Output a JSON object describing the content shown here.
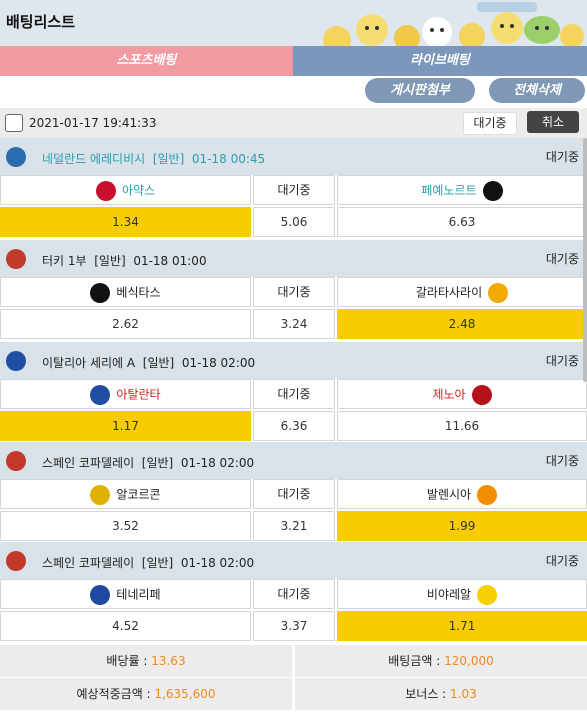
{
  "header": {
    "title": "배팅리스트"
  },
  "tabs": {
    "sports": "스포츠배팅",
    "live": "라이브배팅"
  },
  "actions": {
    "notice": "게시판첨부",
    "delete_all": "전체삭제"
  },
  "datebar": {
    "datetime": "2021-01-17 19:41:33",
    "status": "대기중",
    "cancel": "취소"
  },
  "draw_label": "대기중",
  "matches": [
    {
      "league": "네덜란드 에레디비시",
      "type": "[일반]",
      "time": "01-18 00:45",
      "status": "대기중",
      "home": "아약스",
      "away": "페예노르트",
      "odds_home": "1.34",
      "odds_draw": "5.06",
      "odds_away": "6.63",
      "selected": "home",
      "home_color": "#c8102e",
      "away_color": "#111111"
    },
    {
      "league": "터키 1부",
      "type": "[일반]",
      "time": "01-18 01:00",
      "status": "대기중",
      "home": "베식타스",
      "away": "갈라타사라이",
      "odds_home": "2.62",
      "odds_draw": "3.24",
      "odds_away": "2.48",
      "selected": "away",
      "home_color": "#111111",
      "away_color": "#f2a900"
    },
    {
      "league": "이탈리아 세리에 A",
      "type": "[일반]",
      "time": "01-18 02:00",
      "status": "대기중",
      "home": "아탈란타",
      "away": "제노아",
      "odds_home": "1.17",
      "odds_draw": "6.36",
      "odds_away": "11.66",
      "selected": "home",
      "home_color": "#1f4ea3",
      "away_color": "#b5121b"
    },
    {
      "league": "스페인 코파델레이",
      "type": "[일반]",
      "time": "01-18 02:00",
      "status": "대기중",
      "home": "알코르콘",
      "away": "발렌시아",
      "odds_home": "3.52",
      "odds_draw": "3.21",
      "odds_away": "1.99",
      "selected": "away",
      "home_color": "#e0b000",
      "away_color": "#f28c00"
    },
    {
      "league": "스페인 코파델레이",
      "type": "[일반]",
      "time": "01-18 02:00",
      "status": "대기중",
      "home": "테네리페",
      "away": "비야레알",
      "odds_home": "4.52",
      "odds_draw": "3.37",
      "odds_away": "1.71",
      "selected": "away",
      "home_color": "#1d4aa0",
      "away_color": "#f5d000"
    }
  ],
  "summary": {
    "odds_label": "배당률 : ",
    "odds_value": "13.63",
    "bet_label": "배팅금액 : ",
    "bet_value": "120,000",
    "expected_label": "예상적중금액 : ",
    "expected_value": "1,635,600",
    "bonus_label": "보너스 : ",
    "bonus_value": "1.03"
  }
}
